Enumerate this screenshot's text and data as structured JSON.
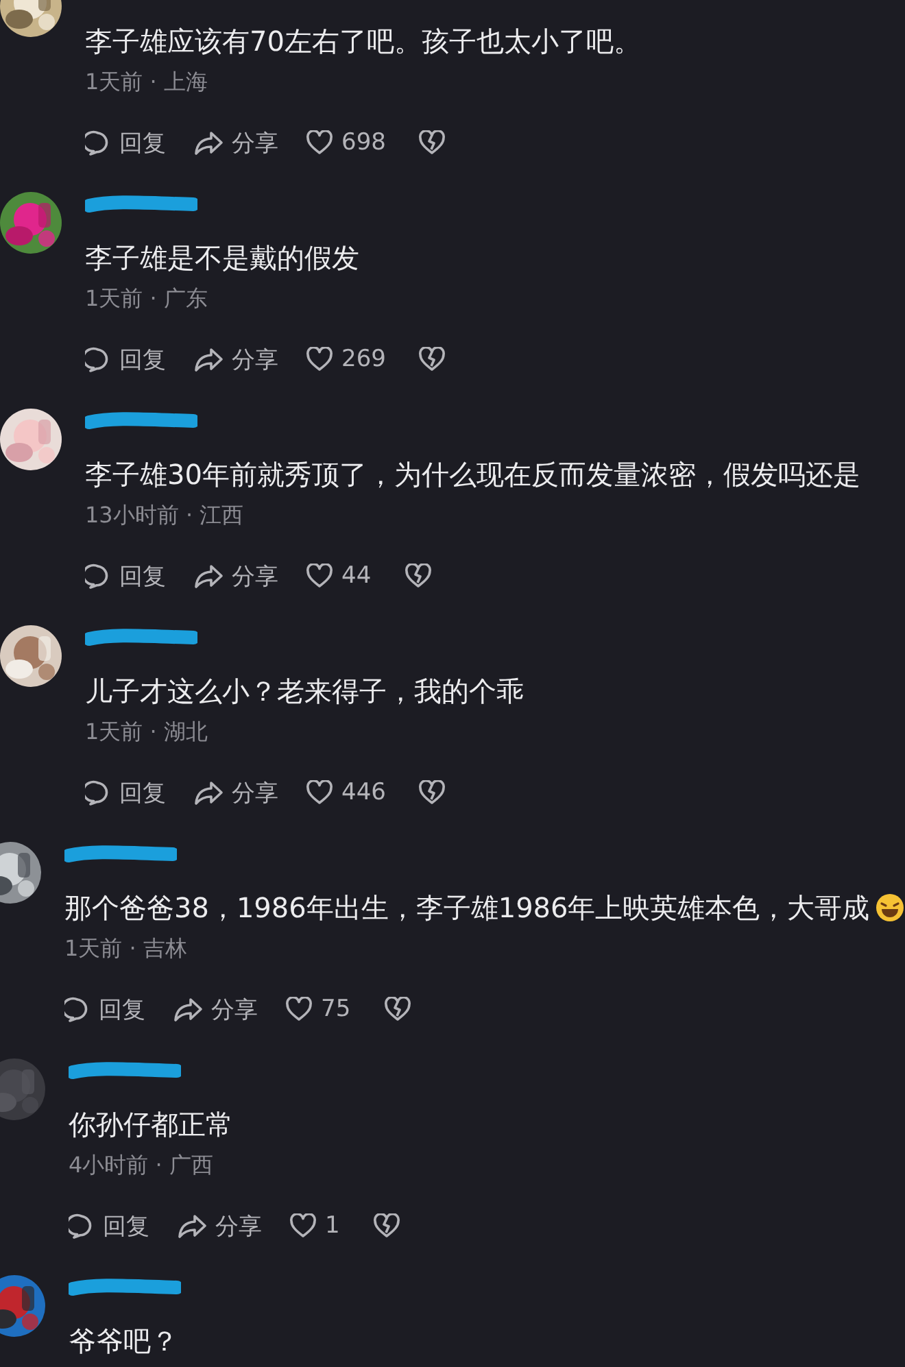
{
  "comments": [
    {
      "kind": "plain",
      "text": "李子雄应该有70左右了吧。孩子也太小了吧。",
      "meta": "1天前 · 上海",
      "reply": "回复",
      "share": "分享",
      "likes": "698"
    },
    {
      "kind": "plain",
      "text": "李子雄是不是戴的假发",
      "meta": "1天前 · 广东",
      "reply": "回复",
      "share": "分享",
      "likes": "269"
    },
    {
      "kind": "plain",
      "text": "李子雄30年前就秀顶了，为什么现在反而发量浓密，假发吗还是",
      "meta": "13小时前 · 江西",
      "reply": "回复",
      "share": "分享",
      "likes": "44"
    },
    {
      "kind": "plain",
      "text": "儿子才这么小？老来得子，我的个乖",
      "meta": "1天前 · 湖北",
      "reply": "回复",
      "share": "分享",
      "likes": "446"
    },
    {
      "kind": "emoji",
      "text": "那个爸爸38，1986年出生，李子雄1986年上映英雄本色，大哥成",
      "meta": "1天前 · 吉林",
      "reply": "回复",
      "share": "分享",
      "likes": "75"
    },
    {
      "kind": "plain",
      "text": "你孙仔都正常",
      "meta": "4小时前 · 广西",
      "reply": "回复",
      "share": "分享",
      "likes": "1"
    },
    {
      "kind": "plain",
      "text": "爷爷吧？"
    }
  ]
}
